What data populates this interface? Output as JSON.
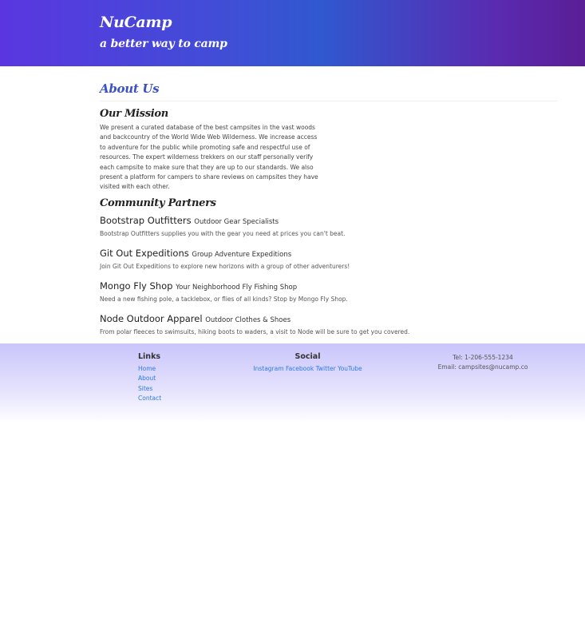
{
  "header": {
    "brand": "NuCamp",
    "tagline": "a better way to camp"
  },
  "page": {
    "title": "About Us"
  },
  "mission": {
    "heading": "Our Mission",
    "text": "We present a curated database of the best campsites in the vast woods and backcountry of the World Wide Web Wilderness. We increase access to adventure for the public while promoting safe and respectful use of resources. The expert wilderness trekkers on our staff personally verify each campsite to make sure that they are up to our standards. We also present a platform for campers to share reviews on campsites they have visited with each other."
  },
  "partners": {
    "heading": "Community Partners",
    "items": [
      {
        "name": "Bootstrap Outfitters",
        "subtitle": "Outdoor Gear Specialists",
        "description": "Bootstrap Outfitters supplies you with the gear you need at prices you can't beat."
      },
      {
        "name": "Git Out Expeditions",
        "subtitle": "Group Adventure Expeditions",
        "description": "Join Git Out Expeditions to explore new horizons with a group of other adventurers!"
      },
      {
        "name": "Mongo Fly Shop",
        "subtitle": "Your Neighborhood Fly Fishing Shop",
        "description": "Need a new fishing pole, a tacklebox, or flies of all kinds? Stop by Mongo Fly Shop."
      },
      {
        "name": "Node Outdoor Apparel",
        "subtitle": "Outdoor Clothes & Shoes",
        "description": "From polar fleeces to swimsuits, hiking boots to waders, a visit to Node will be sure to get you covered."
      }
    ]
  },
  "footer": {
    "links_title": "Links",
    "links": [
      "Home",
      "About",
      "Sites",
      "Contact"
    ],
    "social_title": "Social",
    "social": [
      "Instagram",
      "Facebook",
      "Twitter",
      "YouTube"
    ],
    "phone": "Tel: 1-206-555-1234",
    "email": "Email: campsites@nucamp.co"
  },
  "colors": {
    "title_accent": "#3a51c9",
    "link": "#2c7be5",
    "header_gradient_start": "#5a36e0",
    "header_gradient_end": "#5a1e96"
  }
}
